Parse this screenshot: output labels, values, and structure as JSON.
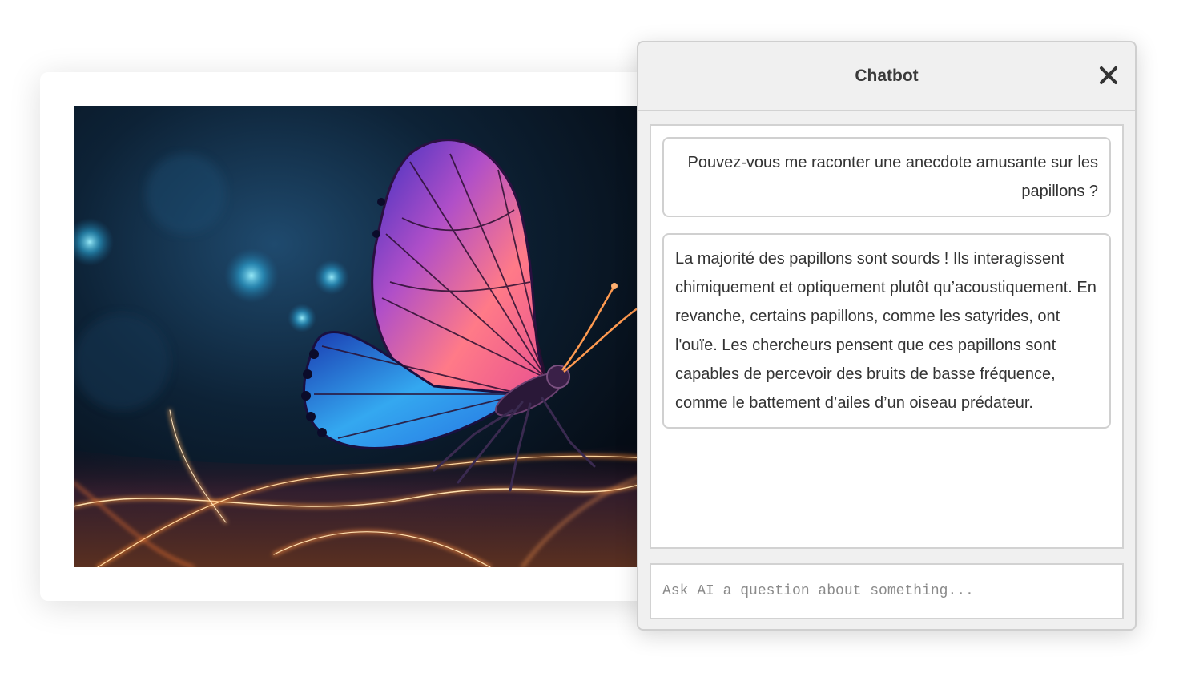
{
  "chatbot": {
    "title": "Chatbot",
    "close_icon": "close-icon",
    "messages": [
      {
        "role": "user",
        "text": "Pouvez-vous me raconter une anecdote amusante sur les papillons ?"
      },
      {
        "role": "assistant",
        "text": "La majorité des papillons sont sourds ! Ils interagissent chimiquement et optiquement plutôt qu’acoustiquement. En revanche, certains papillons, comme les satyrides, ont l'ouïe. Les chercheurs pensent que ces papillons sont capables de percevoir des bruits de basse fréquence, comme le battement d’ailes d’un oiseau prédateur."
      }
    ],
    "input": {
      "value": "",
      "placeholder": "Ask AI a question about something..."
    }
  },
  "colors": {
    "panel_bg": "#f0f0f0",
    "border": "#d0d0d0",
    "text": "#333333"
  }
}
